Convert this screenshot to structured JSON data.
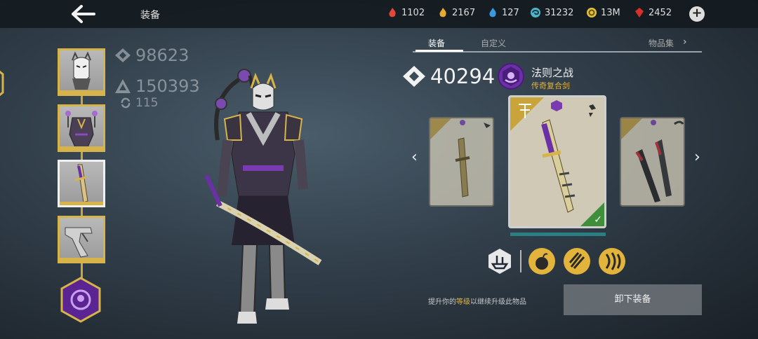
{
  "header": {
    "title": "装备",
    "currencies": [
      {
        "icon": "red-flame-icon",
        "color": "#e0483a",
        "value": "1102"
      },
      {
        "icon": "gold-flame-icon",
        "color": "#e7a935",
        "value": "2167"
      },
      {
        "icon": "blue-flame-icon",
        "color": "#3a9ae0",
        "value": "127"
      },
      {
        "icon": "swirl-coin-icon",
        "color": "#4db7c9",
        "value": "31232"
      },
      {
        "icon": "gold-coin-icon",
        "color": "#e3c23a",
        "value": "13M"
      },
      {
        "icon": "red-gem-icon",
        "color": "#d6302a",
        "value": "2452"
      }
    ]
  },
  "stats": {
    "power": "98623",
    "total": "150393",
    "level": "115"
  },
  "slots": [
    {
      "name": "helmet",
      "active": false
    },
    {
      "name": "armor",
      "active": false
    },
    {
      "name": "weapon",
      "active": true
    },
    {
      "name": "ranged",
      "active": false
    }
  ],
  "tabs": {
    "equip": "装备",
    "custom": "自定义",
    "collection": "物品集"
  },
  "item": {
    "power": "40294",
    "name": "法则之战",
    "rarity": "传奇复合剑"
  },
  "hint": {
    "prefix": "提升你的",
    "highlight": "等级",
    "suffix": "以继续升级此物品"
  },
  "unequip_label": "卸下装备",
  "colors": {
    "accent_gold": "#d7b44a",
    "legendary_purple": "#6b2fa6",
    "equipped_green": "#3f8e3a"
  }
}
